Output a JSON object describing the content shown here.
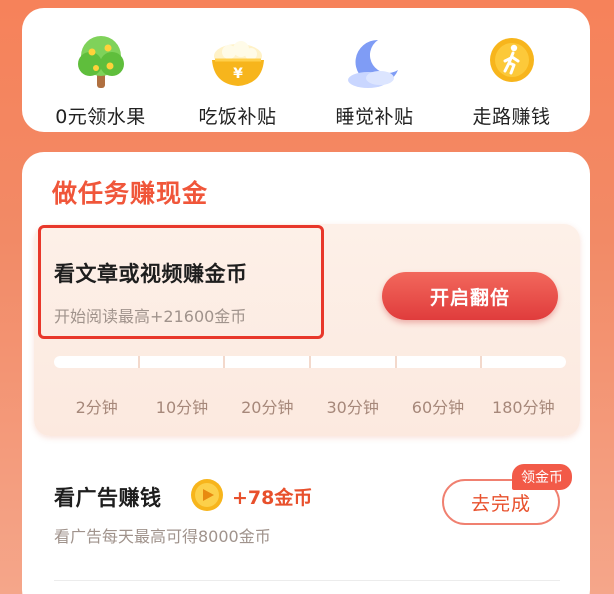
{
  "quick_entries": [
    {
      "label": "0元领水果",
      "icon": "fruit-tree-icon"
    },
    {
      "label": "吃饭补贴",
      "icon": "rice-bowl-icon"
    },
    {
      "label": "睡觉补贴",
      "icon": "moon-icon"
    },
    {
      "label": "走路赚钱",
      "icon": "walking-icon"
    }
  ],
  "task_section": {
    "title": "做任务赚现金",
    "reading": {
      "title": "看文章或视频赚金币",
      "subtitle": "开始阅读最高+21600金币",
      "button_label": "开启翻倍",
      "milestones": [
        "2分钟",
        "10分钟",
        "20分钟",
        "30分钟",
        "60分钟",
        "180分钟"
      ],
      "progress": 0
    },
    "ad": {
      "title": "看广告赚钱",
      "reward": "+78金币",
      "subtitle": "看广告每天最高可得8000金币",
      "badge": "领金币",
      "button_label": "去完成"
    }
  },
  "colors": {
    "accent": "#f0563a",
    "button_red": "#e03c3c",
    "background_top": "#f6825a"
  }
}
